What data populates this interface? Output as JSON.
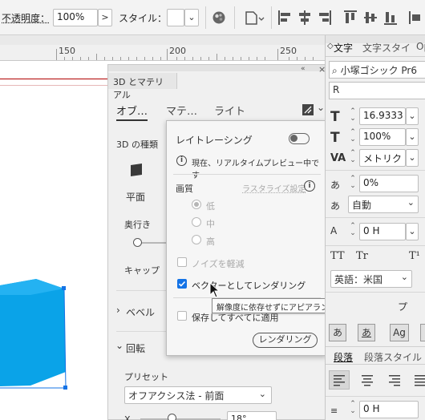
{
  "toolbar": {
    "opacity_label": "不透明度：",
    "opacity_value": "100%",
    "opacity_arrow": ">",
    "style_label": "スタイル：",
    "dropdown_chevron": "⌄"
  },
  "ruler": {
    "marks": [
      "150",
      "200",
      "250"
    ]
  },
  "panel3d": {
    "title": "3D とマテリアル",
    "tabs": [
      "オブ…",
      "マテ…",
      "ライト"
    ],
    "type_label": "3D の種類",
    "flat_label": "平面",
    "depth_label": "奥行き",
    "cap_label": "キャップ",
    "bevel_label": "ベベル",
    "rotation_label": "回転",
    "preset_label": "プリセット",
    "preset_value": "オフアクシス法 - 前面",
    "x_label": "X",
    "x_value": "18°"
  },
  "popup": {
    "raytracing_label": "レイトレーシング",
    "info_text": "現在、リアルタイムプレビュー中です",
    "quality_label": "画質",
    "rasterize_label": "ラスタライズ設定",
    "quality_options": [
      "低",
      "中",
      "高"
    ],
    "reduce_noise_label": "ノイズを軽減",
    "vector_render_label": "ベクターとしてレンダリング",
    "save_label": "保存してすべてに適用",
    "render_button": "レンダリング"
  },
  "tooltip": {
    "text": "解像度に依存せずにアピアランスをレンダリング"
  },
  "right_panel": {
    "tabs": [
      "文字",
      "文字スタイ",
      "Ope"
    ],
    "font_name": "小塚ゴシック Pr6",
    "font_style": "R",
    "font_size": "16.9333",
    "vscale": "100%",
    "kerning": "メトリク",
    "tracking": "0%",
    "auto_label": "自動",
    "baseline": "0 H",
    "tt_caps": "TT",
    "tt_small": "Tr",
    "tt_super": "T¹",
    "language": "英語：米国",
    "partial_text": "プ",
    "para_tabs": [
      "段落",
      "段落スタイル"
    ],
    "indent_value": "0 H",
    "a_glyph_1": "あ",
    "a_glyph_2": "あ",
    "a_glyph_3": "Ag",
    "a_glyph_4": "あ"
  },
  "colors": {
    "accent": "#1473e6",
    "shape": "#0aa3e8",
    "guide": "#b00000"
  }
}
